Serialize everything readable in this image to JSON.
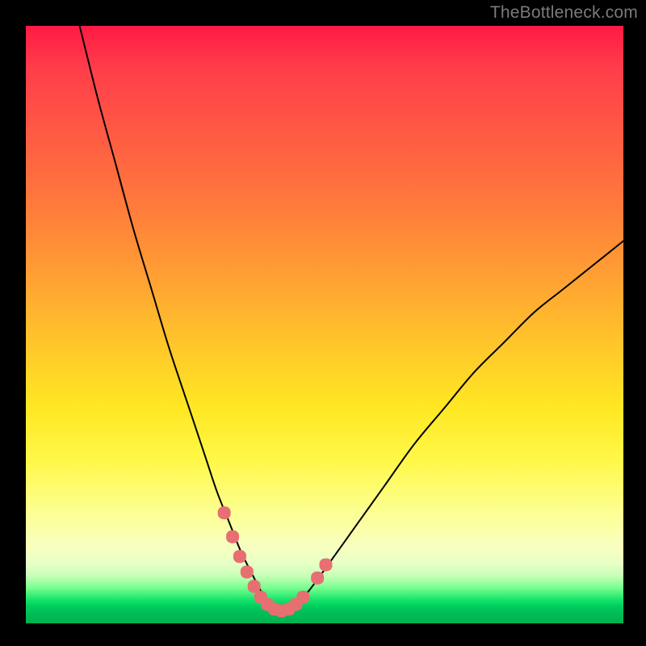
{
  "watermark": "TheBottleneck.com",
  "colors": {
    "curve_stroke": "#000000",
    "marker_fill": "#e76f72",
    "gradient_top": "#ff1a44",
    "gradient_bottom": "#00b050"
  },
  "chart_data": {
    "type": "line",
    "title": "",
    "xlabel": "",
    "ylabel": "",
    "xlim": [
      0,
      100
    ],
    "ylim": [
      0,
      100
    ],
    "grid": false,
    "legend": false,
    "series": [
      {
        "name": "curve",
        "x": [
          9,
          12,
          15,
          18,
          21,
          24,
          27,
          30,
          32,
          34,
          36,
          38,
          39,
          40,
          41,
          42,
          43,
          44,
          45,
          47,
          50,
          55,
          60,
          65,
          70,
          75,
          80,
          85,
          90,
          95,
          100
        ],
        "y": [
          100,
          88,
          77,
          66,
          56,
          46,
          37,
          28,
          22,
          17,
          12,
          8,
          6,
          4.5,
          3.2,
          2.3,
          1.8,
          2.2,
          3.0,
          5.0,
          9.0,
          16,
          23,
          30,
          36,
          42,
          47,
          52,
          56,
          60,
          64
        ]
      }
    ],
    "markers": [
      {
        "x": 33.2,
        "y": 18.5
      },
      {
        "x": 34.6,
        "y": 14.5
      },
      {
        "x": 35.8,
        "y": 11.2
      },
      {
        "x": 37.0,
        "y": 8.6
      },
      {
        "x": 38.2,
        "y": 6.2
      },
      {
        "x": 39.3,
        "y": 4.4
      },
      {
        "x": 40.4,
        "y": 3.2
      },
      {
        "x": 41.6,
        "y": 2.4
      },
      {
        "x": 42.8,
        "y": 2.1
      },
      {
        "x": 44.0,
        "y": 2.4
      },
      {
        "x": 45.2,
        "y": 3.2
      },
      {
        "x": 46.4,
        "y": 4.4
      },
      {
        "x": 48.8,
        "y": 7.6
      },
      {
        "x": 50.2,
        "y": 9.8
      }
    ]
  }
}
